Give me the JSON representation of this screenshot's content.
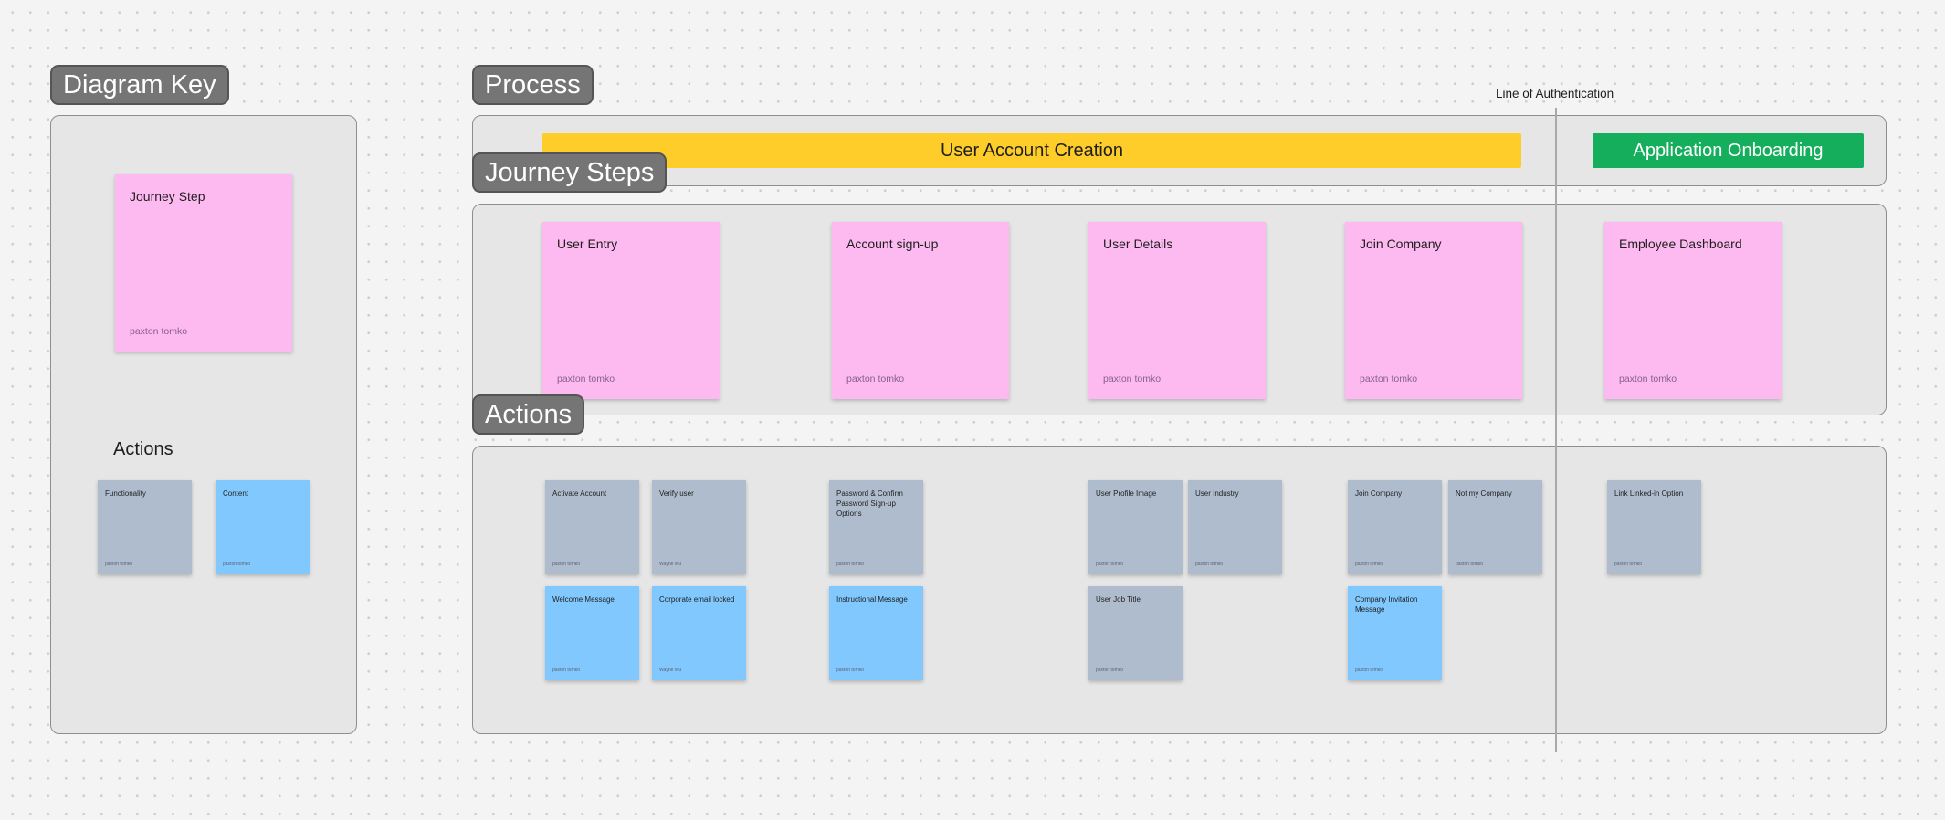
{
  "colors": {
    "journey_step": "#fdbaf0",
    "functionality": "#afbccd",
    "content": "#80c8fe",
    "user_account_creation": "#ffcd29",
    "application_onboarding": "#14ae5c",
    "section_label_bg": "#757575"
  },
  "key": {
    "label": "Diagram Key",
    "journey_step": {
      "title": "Journey Step",
      "author": "paxton tomko"
    },
    "actions_heading": "Actions",
    "functionality": {
      "title": "Functionality",
      "author": "paxton tomko"
    },
    "content": {
      "title": "Content",
      "author": "paxton tomko"
    }
  },
  "process": {
    "label": "Process",
    "line_label": "Line of Authentication",
    "phases": [
      {
        "label": "User Account Creation"
      },
      {
        "label": "Application Onboarding"
      }
    ]
  },
  "journey": {
    "label": "Journey Steps",
    "steps": [
      {
        "title": "User Entry",
        "author": "paxton tomko"
      },
      {
        "title": "Account sign-up",
        "author": "paxton tomko"
      },
      {
        "title": "User Details",
        "author": "paxton tomko"
      },
      {
        "title": "Join Company",
        "author": "paxton tomko"
      },
      {
        "title": "Employee Dashboard",
        "author": "paxton tomko"
      }
    ]
  },
  "actions": {
    "label": "Actions",
    "items": [
      {
        "title": "Activate Account",
        "author": "paxton tomko",
        "kind": "functionality"
      },
      {
        "title": "Verify user",
        "author": "Wayne Wu",
        "kind": "functionality"
      },
      {
        "title": "Password & Confirm Password Sign-up Options",
        "author": "paxton tomko",
        "kind": "functionality"
      },
      {
        "title": "User Profile Image",
        "author": "paxton tomko",
        "kind": "functionality"
      },
      {
        "title": "User Industry",
        "author": "paxton tomko",
        "kind": "functionality"
      },
      {
        "title": "Join Company",
        "author": "paxton tomko",
        "kind": "functionality"
      },
      {
        "title": "Not my Company",
        "author": "paxton tomko",
        "kind": "functionality"
      },
      {
        "title": "Link Linked-in Option",
        "author": "paxton tomko",
        "kind": "functionality"
      },
      {
        "title": "Welcome Message",
        "author": "paxton tomko",
        "kind": "content"
      },
      {
        "title": "Corporate email locked",
        "author": "Wayne Wu",
        "kind": "content"
      },
      {
        "title": "Instructional Message",
        "author": "paxton tomko",
        "kind": "content"
      },
      {
        "title": "User Job Title",
        "author": "paxton tomko",
        "kind": "functionality"
      },
      {
        "title": "Company Invitation Message",
        "author": "paxton tomko",
        "kind": "content"
      }
    ]
  }
}
